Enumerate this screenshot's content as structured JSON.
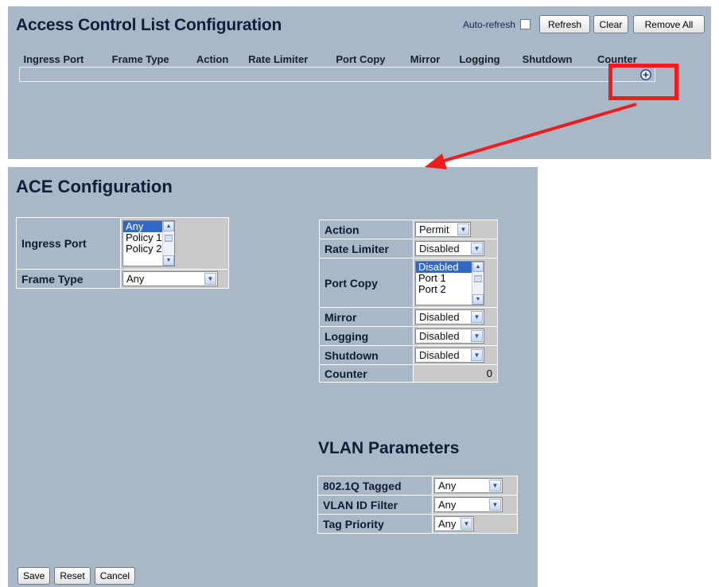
{
  "acl": {
    "title": "Access Control List Configuration",
    "auto_refresh_label": "Auto-refresh",
    "auto_refresh_checked": false,
    "buttons": {
      "refresh": "Refresh",
      "clear": "Clear",
      "remove_all": "Remove All"
    },
    "columns": [
      "Ingress Port",
      "Frame Type",
      "Action",
      "Rate Limiter",
      "Port Copy",
      "Mirror",
      "Logging",
      "Shutdown",
      "Counter"
    ],
    "add_icon": "plus-circle-icon"
  },
  "annotation": {
    "highlight_color": "#ee1c1c"
  },
  "ace": {
    "title": "ACE Configuration",
    "ingress_port": {
      "label": "Ingress Port",
      "options": [
        "Any",
        "Policy 1",
        "Policy 2"
      ],
      "selected": "Any"
    },
    "frame_type": {
      "label": "Frame Type",
      "value": "Any"
    },
    "action": {
      "label": "Action",
      "value": "Permit"
    },
    "rate_limiter": {
      "label": "Rate Limiter",
      "value": "Disabled"
    },
    "port_copy": {
      "label": "Port Copy",
      "options": [
        "Disabled",
        "Port 1",
        "Port 2"
      ],
      "selected": "Disabled"
    },
    "mirror": {
      "label": "Mirror",
      "value": "Disabled"
    },
    "logging": {
      "label": "Logging",
      "value": "Disabled"
    },
    "shutdown": {
      "label": "Shutdown",
      "value": "Disabled"
    },
    "counter": {
      "label": "Counter",
      "value": "0"
    }
  },
  "vlan": {
    "title": "VLAN Parameters",
    "tagged": {
      "label": "802.1Q Tagged",
      "value": "Any"
    },
    "vlan_id_filter": {
      "label": "VLAN ID Filter",
      "value": "Any"
    },
    "tag_priority": {
      "label": "Tag Priority",
      "value": "Any"
    }
  },
  "form_buttons": {
    "save": "Save",
    "reset": "Reset",
    "cancel": "Cancel"
  },
  "colors": {
    "panel_bg": "#a9b8c6",
    "selected_bg": "#3168c8",
    "annotation": "#ee1c1c"
  }
}
